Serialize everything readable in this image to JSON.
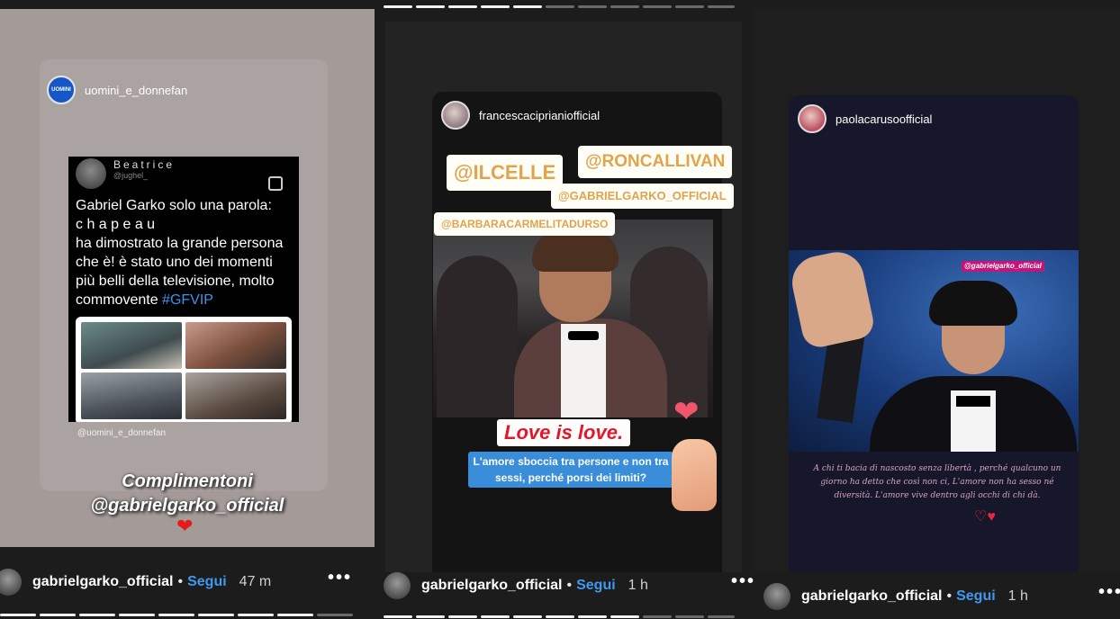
{
  "panels": [
    {
      "header_user": "uomini_e_donnefan",
      "tweet": {
        "name": "Beatrice",
        "handle": "@jughel_",
        "text_main": "Gabriel Garko solo una parola:\nc h a p e a u\nha dimostrato la grande persona che è! è stato uno dei momenti più belli della televisione, molto commovente",
        "hashtag": "#GFVIP"
      },
      "credit": "@uomini_e_donnefan",
      "caption_line1": "Complimentoni",
      "caption_line2": "@gabrielgarko_official",
      "heart": "❤"
    },
    {
      "header_user": "francescaciprianiofficial",
      "stickers": [
        "@ILCELLE",
        "@RONCALLIVAN",
        "@GABRIELGARKO_OFFICIAL",
        "@BARBARACARMELITADURSO"
      ],
      "love_text": "Love is love.",
      "blue_caption": "L'amore sboccia tra persone e non tra sessi, perché porsi dei limiti?",
      "heart": "❤"
    },
    {
      "header_user": "paolacarusoofficial",
      "mention": "@gabrielgarko_official",
      "quote": "A chi ti bacia di nascosto senza libertà , perché qualcuno un giorno ha detto che così non ci, L'amore non ha sesso né diversità. L'amore vive dentro agli occhi di chi dà.",
      "hearts": "♡♥"
    }
  ],
  "footers": [
    {
      "username": "gabrielgarko_official",
      "separator": "•",
      "follow": "Segui",
      "time": "47 m",
      "more": "•••"
    },
    {
      "username": "gabrielgarko_official",
      "separator": "•",
      "follow": "Segui",
      "time": "1 h",
      "more": "•••"
    },
    {
      "username": "gabrielgarko_official",
      "separator": "•",
      "follow": "Segui",
      "time": "1 h",
      "more": "•••"
    }
  ],
  "colors": {
    "follow": "#3f99f0",
    "love": "#e3172b",
    "sticker_text": "#e2a34a",
    "caption_bg": "#3a8ed9"
  },
  "progress": {
    "top_segments_seen": 5,
    "top_segments_total": 11
  }
}
